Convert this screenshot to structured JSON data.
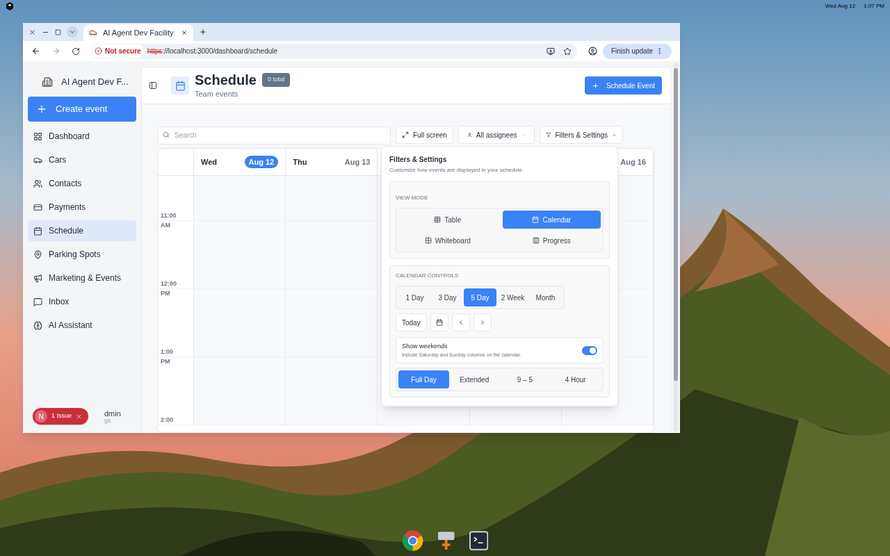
{
  "topbar": {
    "date": "Wed Aug 12",
    "time": "1:07 PM"
  },
  "browser": {
    "tab_title": "AI Agent Dev Facility",
    "security": "Not secure",
    "url_scheme": "https",
    "url_rest": "://localhost:3000/dashboard/schedule",
    "update_button": "Finish update"
  },
  "sidebar": {
    "org": "AI Agent Dev F...",
    "create_button": "Create event",
    "items": [
      {
        "label": "Dashboard",
        "selected": false
      },
      {
        "label": "Cars",
        "selected": false
      },
      {
        "label": "Contacts",
        "selected": false
      },
      {
        "label": "Payments",
        "selected": false
      },
      {
        "label": "Schedule",
        "selected": true
      },
      {
        "label": "Parking Spots",
        "selected": false
      },
      {
        "label": "Marketing & Events",
        "selected": false
      },
      {
        "label": "Inbox",
        "selected": false
      },
      {
        "label": "AI Assistant",
        "selected": false
      }
    ],
    "issue_badge": {
      "letter": "N",
      "label": "1 Issue"
    },
    "user_name_part": "dmin",
    "user_sub_part": "gs"
  },
  "header": {
    "title": "Schedule",
    "count": "0 total",
    "subtitle": "Team events",
    "action": "Schedule Event"
  },
  "toolbar": {
    "search_placeholder": "Search",
    "fullscreen": "Full screen",
    "assignees": "All assignees",
    "filters": "Filters & Settings"
  },
  "calendar": {
    "days": [
      {
        "day": "Wed",
        "date": "Aug 12",
        "today": true
      },
      {
        "day": "Thu",
        "date": "Aug 13",
        "today": false
      },
      {
        "date": "Aug 16",
        "today": false
      }
    ],
    "slots": [
      {
        "time": "11:00"
      },
      {
        "period": "AM",
        "time": "12:00"
      },
      {
        "period": "PM",
        "time": "1:00"
      },
      {
        "period": "PM",
        "time": "2:00"
      }
    ]
  },
  "popover": {
    "title": "Filters & Settings",
    "subtitle": "Customize how events are displayed in your schedule.",
    "view_mode_label": "VIEW MODE",
    "view_modes": [
      {
        "label": "Table",
        "selected": false
      },
      {
        "label": "Calendar",
        "selected": true
      },
      {
        "label": "Whiteboard",
        "selected": false
      },
      {
        "label": "Progress",
        "selected": false
      }
    ],
    "controls_label": "CALENDAR CONTROLS",
    "ranges": [
      {
        "label": "1 Day",
        "selected": false
      },
      {
        "label": "3 Day",
        "selected": false
      },
      {
        "label": "5 Day",
        "selected": true
      },
      {
        "label": "2 Week",
        "selected": false
      },
      {
        "label": "Month",
        "selected": false
      }
    ],
    "today_button": "Today",
    "weekends": {
      "title": "Show weekends",
      "description": "Include Saturday and Sunday columns on the calendar.",
      "on": true
    },
    "hours": [
      {
        "label": "Full Day",
        "selected": true
      },
      {
        "label": "Extended",
        "selected": false
      },
      {
        "label": "9 – 5",
        "selected": false
      },
      {
        "label": "4 Hour",
        "selected": false
      }
    ]
  }
}
